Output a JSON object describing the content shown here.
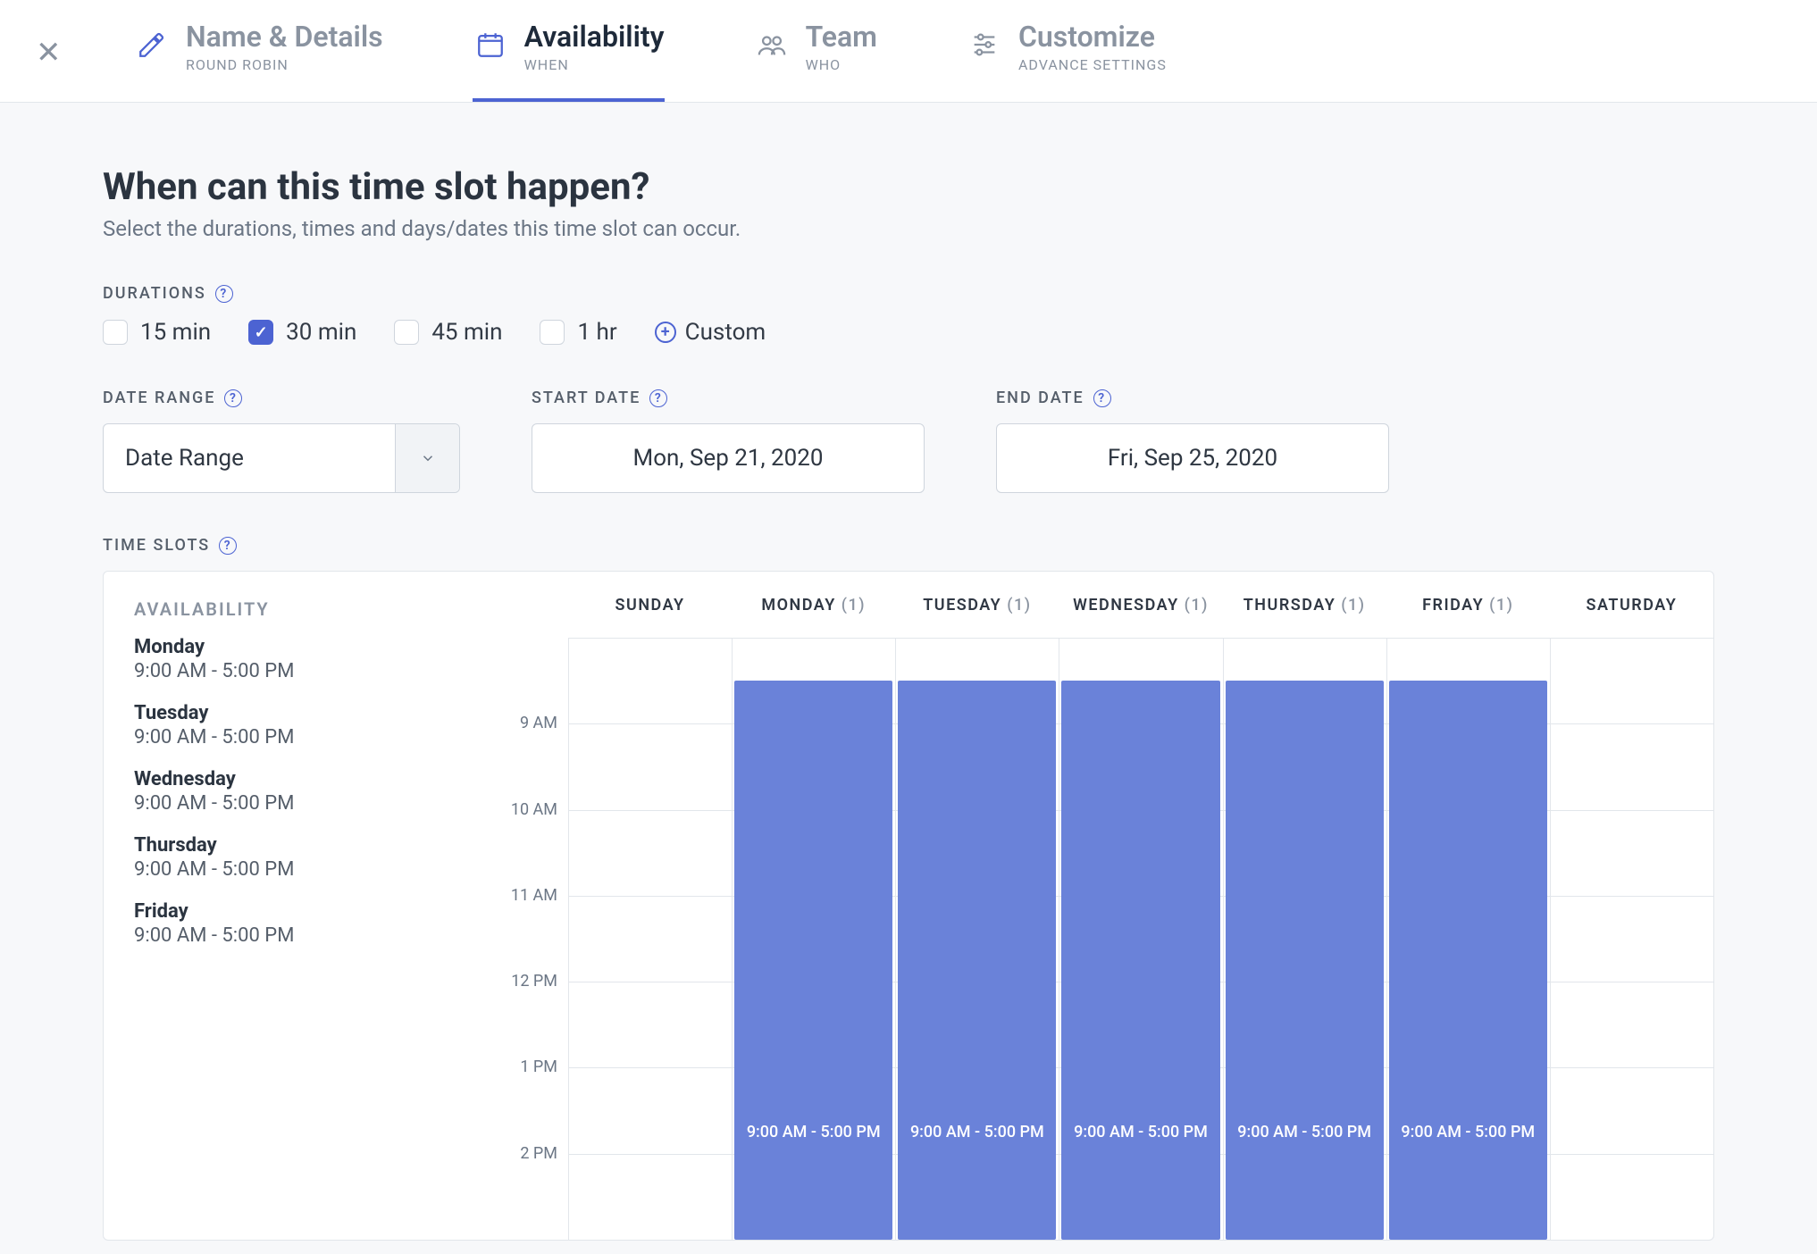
{
  "steps": [
    {
      "title": "Name & Details",
      "sub": "ROUND ROBIN"
    },
    {
      "title": "Availability",
      "sub": "WHEN"
    },
    {
      "title": "Team",
      "sub": "WHO"
    },
    {
      "title": "Customize",
      "sub": "ADVANCE SETTINGS"
    }
  ],
  "active_step_index": 1,
  "heading": "When can this time slot happen?",
  "subheading": "Select the durations, times and days/dates this time slot can occur.",
  "durations": {
    "label": "DURATIONS",
    "options": [
      "15 min",
      "30 min",
      "45 min",
      "1 hr"
    ],
    "checked_index": 1,
    "custom_label": "Custom"
  },
  "date_section": {
    "range_label": "DATE RANGE",
    "range_value": "Date Range",
    "start_label": "START DATE",
    "start_value": "Mon, Sep 21, 2020",
    "end_label": "END DATE",
    "end_value": "Fri, Sep 25, 2020"
  },
  "timeslots_label": "TIME SLOTS",
  "availability_title": "AVAILABILITY",
  "availability_days": [
    {
      "day": "Monday",
      "time": "9:00 AM - 5:00 PM"
    },
    {
      "day": "Tuesday",
      "time": "9:00 AM - 5:00 PM"
    },
    {
      "day": "Wednesday",
      "time": "9:00 AM - 5:00 PM"
    },
    {
      "day": "Thursday",
      "time": "9:00 AM - 5:00 PM"
    },
    {
      "day": "Friday",
      "time": "9:00 AM - 5:00 PM"
    }
  ],
  "calendar": {
    "columns": [
      {
        "label": "SUNDAY"
      },
      {
        "label": "MONDAY",
        "count": "(1)"
      },
      {
        "label": "TUESDAY",
        "count": "(1)"
      },
      {
        "label": "WEDNESDAY",
        "count": "(1)"
      },
      {
        "label": "THURSDAY",
        "count": "(1)"
      },
      {
        "label": "FRIDAY",
        "count": "(1)"
      },
      {
        "label": "SATURDAY"
      }
    ],
    "time_rows": [
      "",
      "9 AM",
      "10 AM",
      "11 AM",
      "12 PM",
      "1 PM",
      "2 PM"
    ],
    "events": [
      {
        "col": 1,
        "label": "9:00 AM - 5:00 PM"
      },
      {
        "col": 2,
        "label": "9:00 AM - 5:00 PM"
      },
      {
        "col": 3,
        "label": "9:00 AM - 5:00 PM"
      },
      {
        "col": 4,
        "label": "9:00 AM - 5:00 PM"
      },
      {
        "col": 5,
        "label": "9:00 AM - 5:00 PM"
      }
    ]
  }
}
